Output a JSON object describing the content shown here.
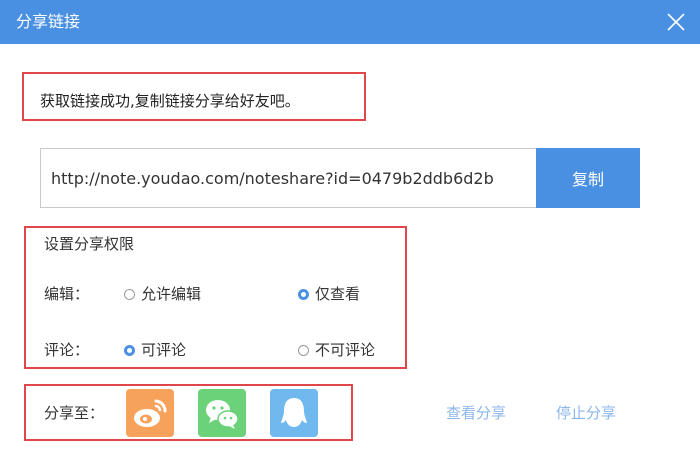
{
  "window": {
    "title": "分享链接",
    "accent": "#4a90e2",
    "close_icon": "close-icon"
  },
  "message": "获取链接成功,复制链接分享给好友吧。",
  "link": {
    "url": "http://note.youdao.com/noteshare?id=0479b2ddb6d2b",
    "copy_label": "复制"
  },
  "permissions": {
    "heading": "设置分享权限",
    "edit": {
      "label": "编辑：",
      "options": [
        "允许编辑",
        "仅查看"
      ],
      "selected": "仅查看"
    },
    "comment": {
      "label": "评论：",
      "options": [
        "可评论",
        "不可评论"
      ],
      "selected": "可评论"
    }
  },
  "share_to": {
    "label": "分享至：",
    "targets": [
      {
        "icon": "weibo-icon",
        "color": "#f7a25a"
      },
      {
        "icon": "wechat-icon",
        "color": "#6cd27a"
      },
      {
        "icon": "qq-icon",
        "color": "#6fb9ee"
      }
    ]
  },
  "actions": {
    "view_share": "查看分享",
    "stop_share": "停止分享"
  },
  "highlight_color": "#e0474c"
}
